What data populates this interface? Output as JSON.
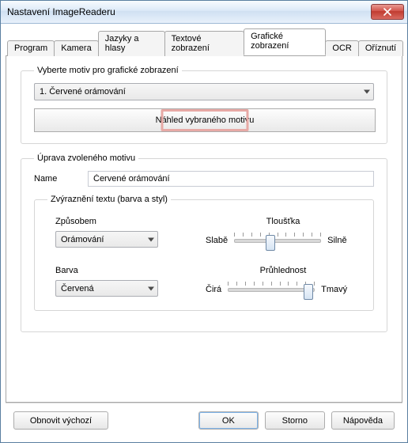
{
  "window": {
    "title": "Nastavení ImageReaderu"
  },
  "tabs": [
    "Program",
    "Kamera",
    "Jazyky a hlasy",
    "Textové zobrazení",
    "Grafické zobrazení",
    "OCR",
    "Oříznutí"
  ],
  "active_tab_index": 4,
  "motive_group": {
    "legend": "Vyberte motiv pro grafické zobrazení",
    "combo_value": "1.  Červené orámování",
    "preview_button": "Náhled vybraného motivu"
  },
  "edit_group": {
    "legend": "Úprava zvoleného motivu",
    "name_label": "Name",
    "name_value": "Červené orámování",
    "highlight_legend": "Zvýraznění textu (barva a styl)",
    "method_label": "Způsobem",
    "method_value": "Orámování",
    "color_label": "Barva",
    "color_value": "Červená",
    "thickness_label": "Tloušťka",
    "thickness_left": "Slabě",
    "thickness_right": "Silně",
    "opacity_label": "Průhlednost",
    "opacity_left": "Čirá",
    "opacity_right": "Tmavý"
  },
  "sliders": {
    "thickness_pos_pct": 42,
    "opacity_pos_pct": 93
  },
  "footer": {
    "restore": "Obnovit výchozí",
    "ok": "OK",
    "cancel": "Storno",
    "help": "Nápověda"
  }
}
